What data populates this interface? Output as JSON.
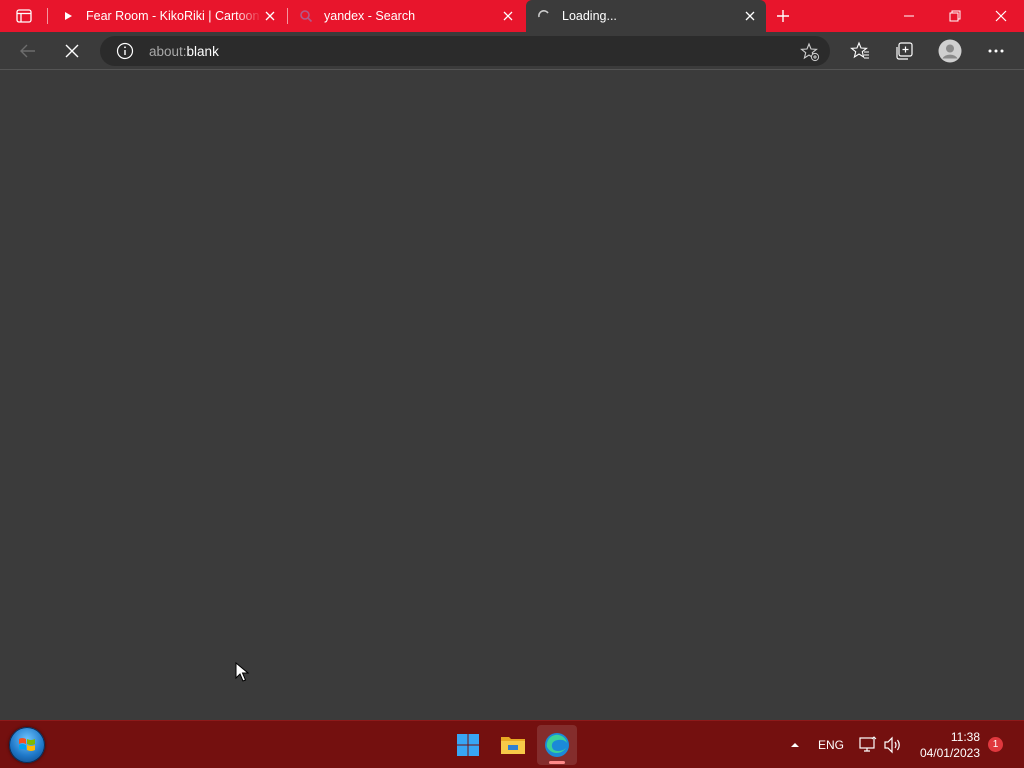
{
  "tabs": [
    {
      "title": "Fear Room - KikoRiki | Cartoon for kids",
      "favicon": "youtube-icon",
      "active": false
    },
    {
      "title": "yandex - Search",
      "favicon": "search-favicon-icon",
      "active": false
    },
    {
      "title": "Loading...",
      "favicon": "loading-spinner-icon",
      "active": true
    }
  ],
  "address_bar": {
    "scheme": "about:",
    "path": "blank",
    "info_icon": "info-icon",
    "favorite_icon": "add-favorite-icon"
  },
  "toolbar": {
    "back_icon": "back-arrow-icon",
    "stop_icon": "stop-loading-icon",
    "favorites_icon": "favorites-icon",
    "collections_icon": "collections-icon",
    "profile_icon": "profile-avatar-icon",
    "menu_icon": "more-menu-icon"
  },
  "taskbar": {
    "language": "ENG",
    "time": "11:38",
    "date": "04/01/2023",
    "notifications": "1"
  },
  "colors": {
    "tabbar": "#e8152c",
    "content": "#3b3b3b",
    "taskbar": "#74100f"
  }
}
